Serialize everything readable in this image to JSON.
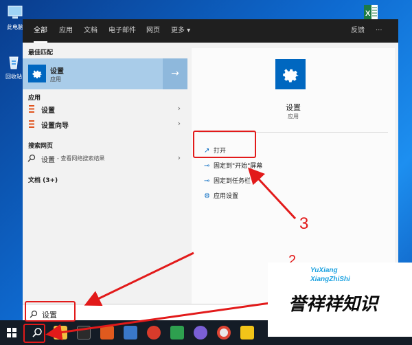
{
  "desktop": {
    "icons": [
      {
        "label": "此电脑"
      },
      {
        "label": "回收站"
      }
    ]
  },
  "topbar": {
    "tabs": [
      {
        "label": "全部",
        "active": true
      },
      {
        "label": "应用"
      },
      {
        "label": "文档"
      },
      {
        "label": "电子邮件"
      },
      {
        "label": "网页"
      },
      {
        "label": "更多 ▾"
      }
    ],
    "feedback_label": "反馈",
    "more_label": "···"
  },
  "best_match": {
    "heading": "最佳匹配",
    "title": "设置",
    "subtitle": "应用",
    "arrow": "→"
  },
  "apps": {
    "heading": "应用",
    "items": [
      {
        "label": "设置",
        "chevron": "›"
      },
      {
        "label": "设置向导",
        "chevron": "›"
      }
    ]
  },
  "web": {
    "heading": "搜索网页",
    "query": "设置",
    "suffix": " - 查看网络搜索结果",
    "chevron": "›"
  },
  "docs": {
    "heading": "文档 (3+)"
  },
  "detail": {
    "title": "设置",
    "subtitle": "应用",
    "actions": [
      {
        "label": "打开",
        "icon": "open-icon"
      },
      {
        "label": "固定到\"开始\"屏幕",
        "icon": "pin-icon"
      },
      {
        "label": "固定到任务栏",
        "icon": "pin-icon"
      },
      {
        "label": "应用设置",
        "icon": "gear-icon"
      }
    ]
  },
  "search": {
    "value": "设置"
  },
  "annotations": {
    "step3": "3",
    "step2": "2"
  },
  "watermark": {
    "line1": "YuXiang",
    "line2": "XiangZhiShi",
    "big": "誉祥祥知识"
  },
  "colors": {
    "accent": "#0067c0",
    "annotation": "#e21a1a"
  }
}
